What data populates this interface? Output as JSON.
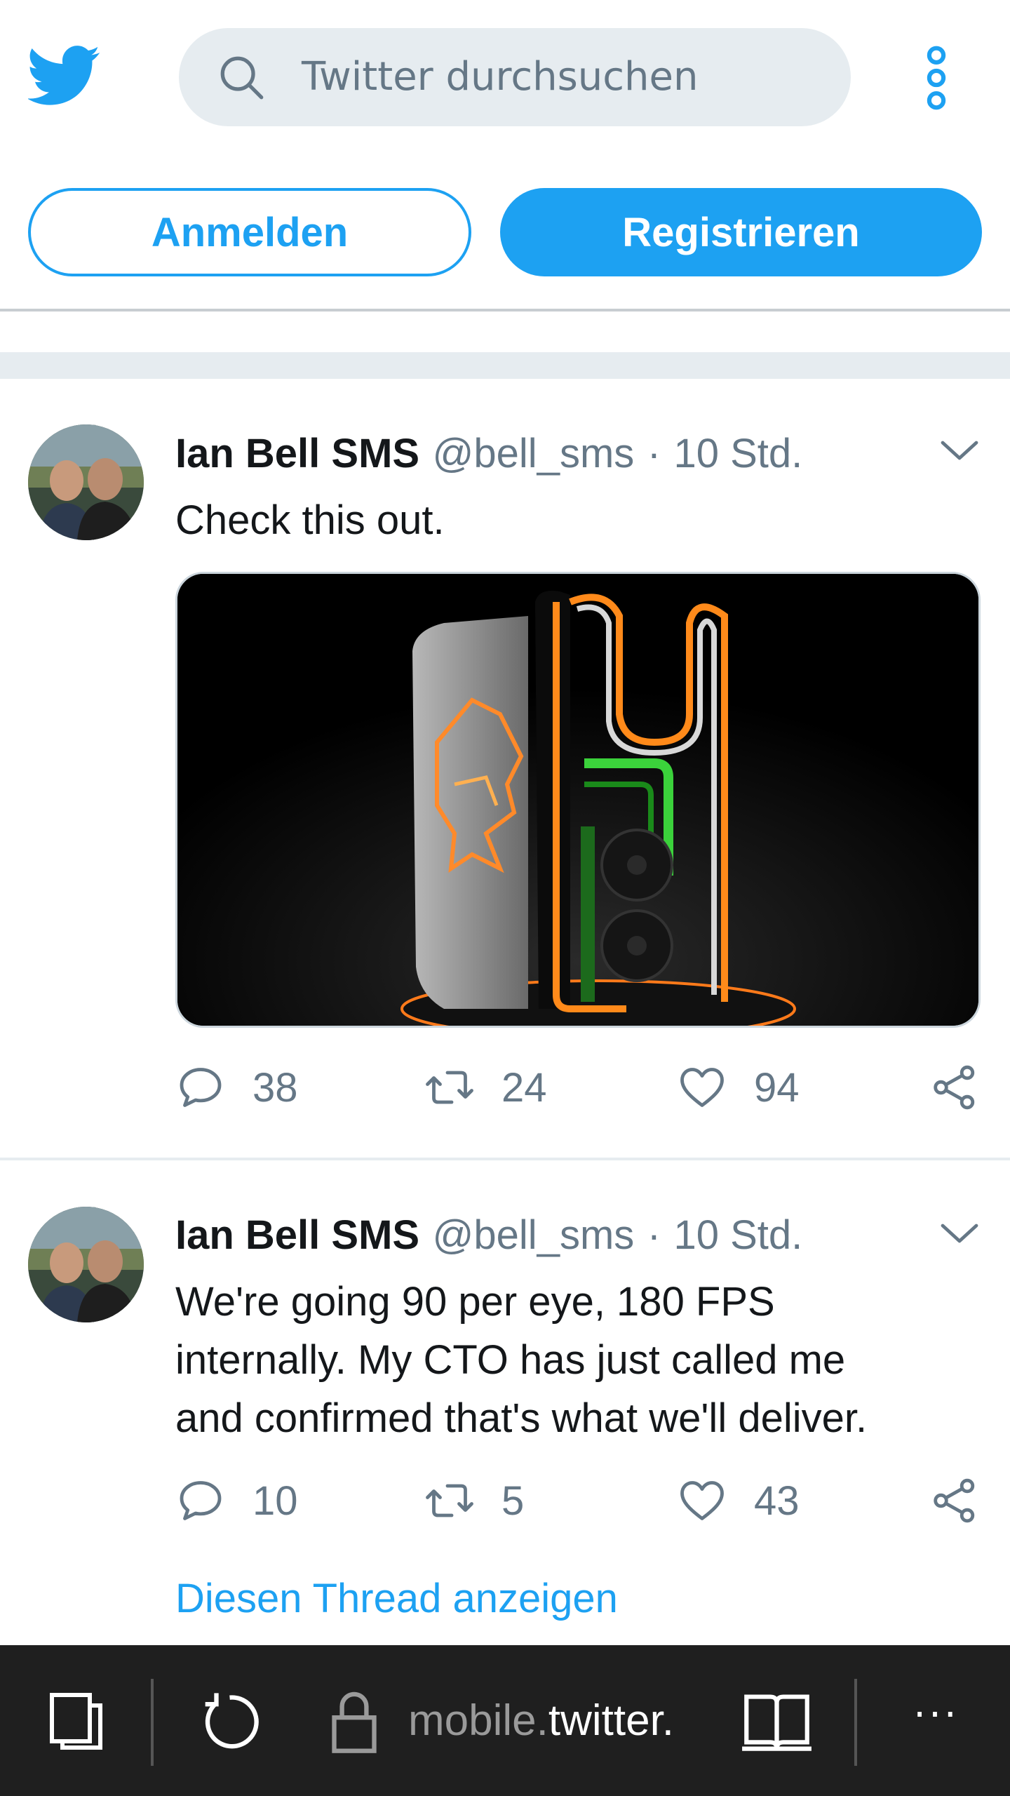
{
  "header": {
    "logo_icon": "twitter-bird-icon",
    "search_placeholder": "Twitter durchsuchen",
    "search_icon": "search-icon",
    "menu_icon": "more-vertical-icon",
    "login_label": "Anmelden",
    "register_label": "Registrieren",
    "accent": "#1da1f2"
  },
  "tweets": [
    {
      "name": "Ian Bell SMS",
      "handle": "@bell_sms",
      "sep": "·",
      "time": "10 Std.",
      "text": "Check this out.",
      "has_media": true,
      "media_alt": "gaming pc case with orange and green lighting",
      "replies": "38",
      "retweets": "24",
      "likes": "94"
    },
    {
      "name": "Ian Bell SMS",
      "handle": "@bell_sms",
      "sep": "·",
      "time": "10 Std.",
      "text_lines": [
        "We're going 90 per eye, 180 FPS",
        "internally. My CTO has just called me",
        "and confirmed that's what we'll deliver."
      ],
      "replies": "10",
      "retweets": "5",
      "likes": "43"
    }
  ],
  "thread_link": "Diesen Thread anzeigen",
  "browser": {
    "url_dim_prefix": "mobile.",
    "url_highlight": "twitter.",
    "icons": [
      "tabs-icon",
      "refresh-icon",
      "lock-icon",
      "reading-view-icon",
      "more-horizontal-icon"
    ],
    "more_label": "···"
  }
}
